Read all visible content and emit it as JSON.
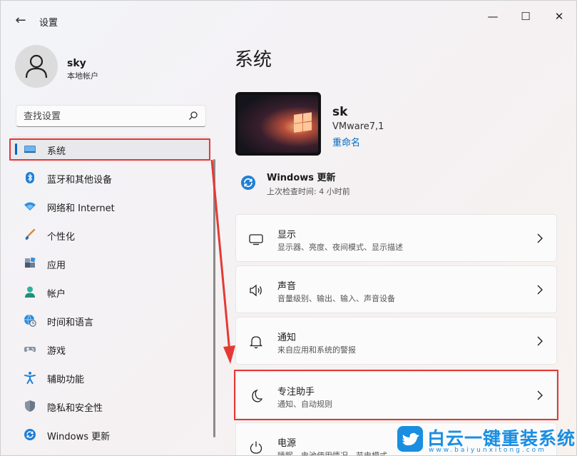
{
  "window": {
    "app_title": "设置",
    "back_glyph": "←",
    "minimize_glyph": "—",
    "maximize_glyph": "☐",
    "close_glyph": "✕"
  },
  "profile": {
    "name": "sky",
    "account_type": "本地帐户"
  },
  "search": {
    "placeholder": "查找设置"
  },
  "nav": {
    "items": [
      {
        "label": "系统",
        "icon": "monitor-icon",
        "active": true
      },
      {
        "label": "蓝牙和其他设备",
        "icon": "bluetooth-icon"
      },
      {
        "label": "网络和 Internet",
        "icon": "wifi-icon"
      },
      {
        "label": "个性化",
        "icon": "brush-icon"
      },
      {
        "label": "应用",
        "icon": "apps-icon"
      },
      {
        "label": "帐户",
        "icon": "person-icon"
      },
      {
        "label": "时间和语言",
        "icon": "globe-clock-icon"
      },
      {
        "label": "游戏",
        "icon": "gamepad-icon"
      },
      {
        "label": "辅助功能",
        "icon": "accessibility-icon"
      },
      {
        "label": "隐私和安全性",
        "icon": "shield-icon"
      },
      {
        "label": "Windows 更新",
        "icon": "update-icon"
      }
    ]
  },
  "main": {
    "title": "系统",
    "device": {
      "name": "sk",
      "model": "VMware7,1",
      "rename_label": "重命名"
    },
    "windows_update": {
      "title": "Windows 更新",
      "subtitle": "上次检查时间: 4 小时前"
    },
    "cards": [
      {
        "title": "显示",
        "subtitle": "显示器、亮度、夜间模式、显示描述",
        "icon": "display-icon"
      },
      {
        "title": "声音",
        "subtitle": "音量级别、输出、输入、声音设备",
        "icon": "speaker-icon"
      },
      {
        "title": "通知",
        "subtitle": "来自应用和系统的警报",
        "icon": "bell-icon"
      },
      {
        "title": "专注助手",
        "subtitle": "通知、自动规则",
        "icon": "moon-icon"
      },
      {
        "title": "电源",
        "subtitle": "睡眠、电池使用情况、节电模式",
        "icon": "power-icon"
      }
    ]
  },
  "watermark": {
    "text": "白云一键重装系统",
    "url": "www.baiyunxitong.com"
  },
  "colors": {
    "accent": "#0067c0",
    "highlight_box": "#e53935",
    "watermark": "#1a8ee1"
  }
}
